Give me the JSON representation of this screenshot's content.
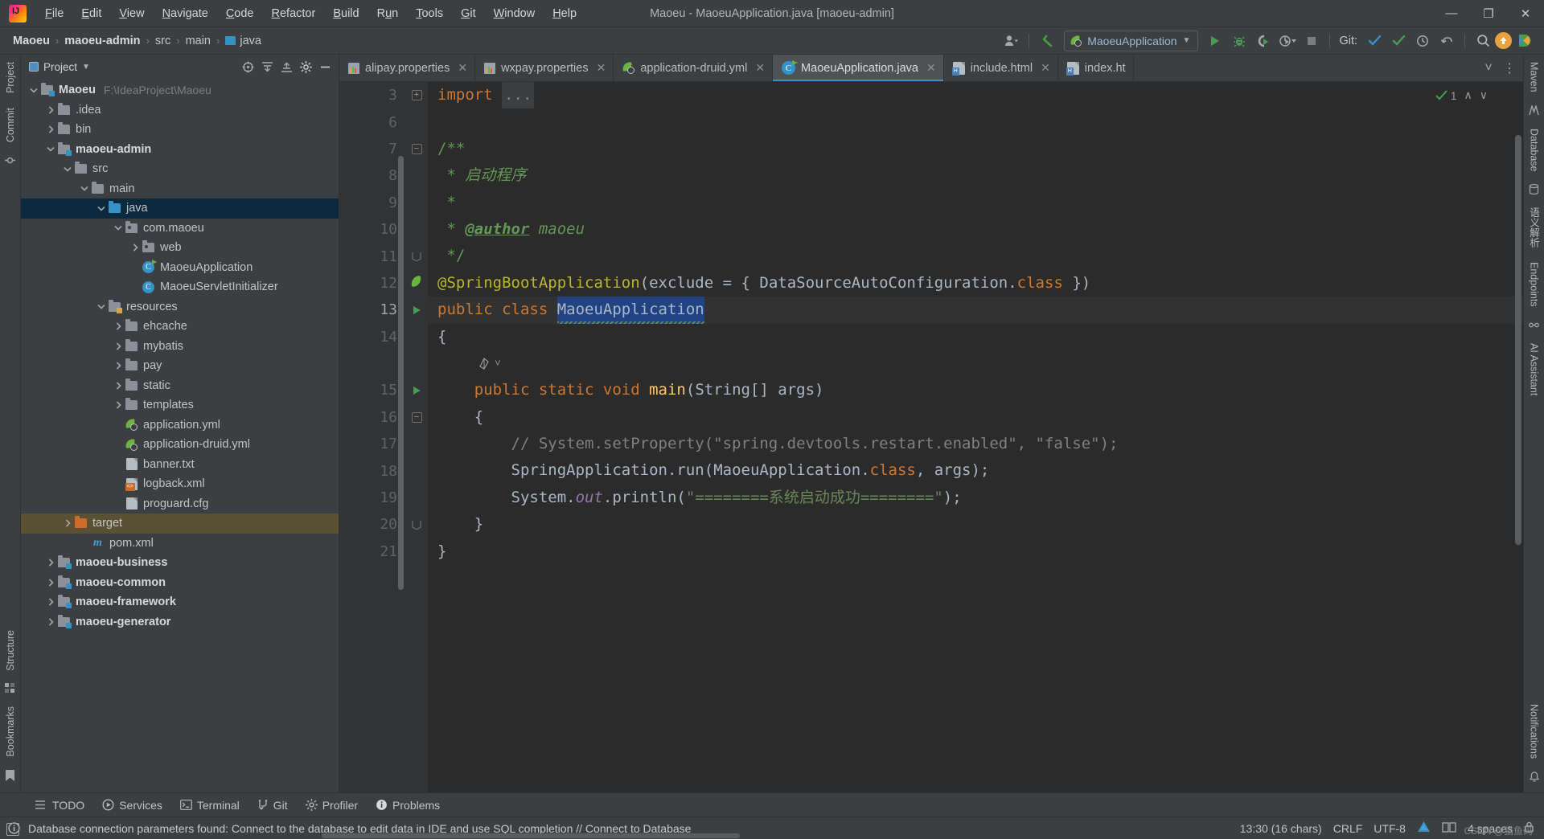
{
  "window": {
    "title": "Maoeu - MaoeuApplication.java [maoeu-admin]",
    "minimize": "—",
    "maximize": "❐",
    "close": "✕"
  },
  "menu": {
    "items": [
      {
        "label": "File"
      },
      {
        "label": "Edit"
      },
      {
        "label": "View"
      },
      {
        "label": "Navigate"
      },
      {
        "label": "Code"
      },
      {
        "label": "Refactor"
      },
      {
        "label": "Build"
      },
      {
        "label": "Run"
      },
      {
        "label": "Tools"
      },
      {
        "label": "Git"
      },
      {
        "label": "Window"
      },
      {
        "label": "Help"
      }
    ]
  },
  "navbar": {
    "breadcrumbs": [
      {
        "label": "Maoeu",
        "bold": true
      },
      {
        "label": "maoeu-admin",
        "bold": true
      },
      {
        "label": "src",
        "bold": false
      },
      {
        "label": "main",
        "bold": false
      },
      {
        "label": "java",
        "bold": false
      }
    ],
    "separator": "›",
    "run_config": "MaoeuApplication",
    "run_config_caret": "▼",
    "git_label": "Git:",
    "icons": {
      "user": "user-icon",
      "back_arrow": "back-arrow-icon",
      "run": "run-icon",
      "debug": "debug-icon",
      "run_coverage": "run-with-coverage-icon",
      "profiler": "profiler-icon",
      "stop": "stop-icon",
      "git_update": "git-update-icon",
      "git_commit": "git-commit-icon",
      "git_history": "git-history-icon",
      "git_rollback": "git-rollback-icon",
      "search": "search-icon",
      "updates": "updates-available-icon",
      "ide_assistant": "ide-assistant-icon"
    }
  },
  "left_strip": {
    "tabs": [
      {
        "label": "Project"
      },
      {
        "label": "Commit"
      },
      {
        "label": "Structure"
      },
      {
        "label": "Bookmarks"
      }
    ]
  },
  "right_strip": {
    "tabs": [
      {
        "label": "Maven"
      },
      {
        "label": "Database"
      },
      {
        "label": "语义解析"
      },
      {
        "label": "Endpoints"
      },
      {
        "label": "AI Assistant"
      },
      {
        "label": "Notifications"
      }
    ]
  },
  "project_panel": {
    "title": "Project",
    "caret": "▼",
    "actions": [
      "locate-icon",
      "expand-all-icon",
      "collapse-all-icon",
      "settings-icon",
      "hide-icon"
    ],
    "tree": [
      {
        "indent": 0,
        "arrow": "down",
        "icon": "module-folder",
        "label": "Maoeu",
        "bold": true,
        "path": "F:\\IdeaProject\\Maoeu"
      },
      {
        "indent": 1,
        "arrow": "right",
        "icon": "folder-grey",
        "label": ".idea",
        "bold": false,
        "path": ""
      },
      {
        "indent": 1,
        "arrow": "right",
        "icon": "folder-grey",
        "label": "bin",
        "bold": false,
        "path": ""
      },
      {
        "indent": 1,
        "arrow": "down",
        "icon": "module-folder",
        "label": "maoeu-admin",
        "bold": true,
        "path": ""
      },
      {
        "indent": 2,
        "arrow": "down",
        "icon": "folder-grey",
        "label": "src",
        "bold": false,
        "path": ""
      },
      {
        "indent": 3,
        "arrow": "down",
        "icon": "folder-grey",
        "label": "main",
        "bold": false,
        "path": ""
      },
      {
        "indent": 4,
        "arrow": "down",
        "icon": "folder-blue",
        "label": "java",
        "bold": false,
        "path": "",
        "selected": true
      },
      {
        "indent": 5,
        "arrow": "down",
        "icon": "package",
        "label": "com.maoeu",
        "bold": false,
        "path": ""
      },
      {
        "indent": 6,
        "arrow": "right",
        "icon": "package",
        "label": "web",
        "bold": false,
        "path": ""
      },
      {
        "indent": 6,
        "arrow": "none",
        "icon": "spring-class",
        "label": "MaoeuApplication",
        "bold": false,
        "path": ""
      },
      {
        "indent": 6,
        "arrow": "none",
        "icon": "java-class",
        "label": "MaoeuServletInitializer",
        "bold": false,
        "path": ""
      },
      {
        "indent": 4,
        "arrow": "down",
        "icon": "resources-folder",
        "label": "resources",
        "bold": false,
        "path": ""
      },
      {
        "indent": 5,
        "arrow": "right",
        "icon": "folder-grey",
        "label": "ehcache",
        "bold": false,
        "path": ""
      },
      {
        "indent": 5,
        "arrow": "right",
        "icon": "folder-grey",
        "label": "mybatis",
        "bold": false,
        "path": ""
      },
      {
        "indent": 5,
        "arrow": "right",
        "icon": "folder-grey",
        "label": "pay",
        "bold": false,
        "path": ""
      },
      {
        "indent": 5,
        "arrow": "right",
        "icon": "folder-grey",
        "label": "static",
        "bold": false,
        "path": ""
      },
      {
        "indent": 5,
        "arrow": "right",
        "icon": "folder-grey",
        "label": "templates",
        "bold": false,
        "path": ""
      },
      {
        "indent": 5,
        "arrow": "none",
        "icon": "spring-yml",
        "label": "application.yml",
        "bold": false,
        "path": ""
      },
      {
        "indent": 5,
        "arrow": "none",
        "icon": "spring-yml",
        "label": "application-druid.yml",
        "bold": false,
        "path": ""
      },
      {
        "indent": 5,
        "arrow": "none",
        "icon": "text-file",
        "label": "banner.txt",
        "bold": false,
        "path": ""
      },
      {
        "indent": 5,
        "arrow": "none",
        "icon": "xml-file",
        "label": "logback.xml",
        "bold": false,
        "path": ""
      },
      {
        "indent": 5,
        "arrow": "none",
        "icon": "cfg-file",
        "label": "proguard.cfg",
        "bold": false,
        "path": ""
      },
      {
        "indent": 2,
        "arrow": "right",
        "icon": "folder-orange",
        "label": "target",
        "bold": false,
        "path": "",
        "target": true
      },
      {
        "indent": 3,
        "arrow": "none",
        "icon": "maven-file",
        "label": "pom.xml",
        "bold": false,
        "path": ""
      },
      {
        "indent": 1,
        "arrow": "right",
        "icon": "module-folder",
        "label": "maoeu-business",
        "bold": true,
        "path": ""
      },
      {
        "indent": 1,
        "arrow": "right",
        "icon": "module-folder",
        "label": "maoeu-common",
        "bold": true,
        "path": ""
      },
      {
        "indent": 1,
        "arrow": "right",
        "icon": "module-folder",
        "label": "maoeu-framework",
        "bold": true,
        "path": ""
      },
      {
        "indent": 1,
        "arrow": "right",
        "icon": "module-folder",
        "label": "maoeu-generator",
        "bold": true,
        "path": ""
      }
    ]
  },
  "editor": {
    "tabs": [
      {
        "label": "alipay.properties",
        "icon": "properties-icon",
        "active": false,
        "close": "✕"
      },
      {
        "label": "wxpay.properties",
        "icon": "properties-icon",
        "active": false,
        "close": "✕"
      },
      {
        "label": "application-druid.yml",
        "icon": "spring-yml-icon",
        "active": false,
        "close": "✕"
      },
      {
        "label": "MaoeuApplication.java",
        "icon": "spring-class-icon",
        "active": true,
        "close": "✕"
      },
      {
        "label": "include.html",
        "icon": "html-icon",
        "active": false,
        "close": "✕"
      },
      {
        "label": "index.ht",
        "icon": "html-icon",
        "active": false,
        "close": ""
      }
    ],
    "tab_overflow": "˅",
    "tab_more": "⋮",
    "inspection_count": "1",
    "inspection_up": "∧",
    "inspection_down": "∨",
    "inlay_hint": "spring-bean-hint",
    "lines": [
      {
        "num": "3",
        "glyph": "fold-plus",
        "segments": [
          {
            "t": "import ",
            "c": "kw"
          },
          {
            "t": "...",
            "c": "fold"
          }
        ]
      },
      {
        "num": "6",
        "glyph": "",
        "segments": []
      },
      {
        "num": "7",
        "glyph": "fold-minus",
        "segments": [
          {
            "t": "/**",
            "c": "doc"
          }
        ]
      },
      {
        "num": "8",
        "glyph": "",
        "segments": [
          {
            "t": " * ",
            "c": "doc"
          },
          {
            "t": "启动程序",
            "c": "docit"
          }
        ]
      },
      {
        "num": "9",
        "glyph": "",
        "segments": [
          {
            "t": " *",
            "c": "doc"
          }
        ]
      },
      {
        "num": "10",
        "glyph": "",
        "segments": [
          {
            "t": " * ",
            "c": "doc"
          },
          {
            "t": "@author",
            "c": "atag"
          },
          {
            "t": " maoeu",
            "c": "docit"
          }
        ]
      },
      {
        "num": "11",
        "glyph": "fold-end",
        "segments": [
          {
            "t": " */",
            "c": "doc"
          }
        ]
      },
      {
        "num": "12",
        "glyph": "spring-bean",
        "segments": [
          {
            "t": "@SpringBootApplication",
            "c": "ann"
          },
          {
            "t": "(exclude = { DataSourceAutoConfiguration.",
            "c": "plain"
          },
          {
            "t": "class",
            "c": "kw"
          },
          {
            "t": " })",
            "c": "plain"
          }
        ]
      },
      {
        "num": "13",
        "glyph": "run",
        "highlight": true,
        "segments": [
          {
            "t": "public class ",
            "c": "kw"
          },
          {
            "t": "MaoeuApplication",
            "c": "selword"
          }
        ]
      },
      {
        "num": "14",
        "glyph": "",
        "segments": [
          {
            "t": "{",
            "c": "plain"
          }
        ]
      },
      {
        "num": "",
        "glyph": "",
        "inlay": true,
        "segments": []
      },
      {
        "num": "15",
        "glyph": "run",
        "segments": [
          {
            "t": "    public static void ",
            "c": "kw"
          },
          {
            "t": "main",
            "c": "mth"
          },
          {
            "t": "(String[] args)",
            "c": "plain"
          }
        ]
      },
      {
        "num": "16",
        "glyph": "fold-minus",
        "segments": [
          {
            "t": "    {",
            "c": "plain"
          }
        ]
      },
      {
        "num": "17",
        "glyph": "",
        "segments": [
          {
            "t": "        // System.setProperty(\"spring.devtools.restart.enabled\", \"false\");",
            "c": "cmt"
          }
        ]
      },
      {
        "num": "18",
        "glyph": "",
        "segments": [
          {
            "t": "        SpringApplication.",
            "c": "plain"
          },
          {
            "t": "run",
            "c": "plain"
          },
          {
            "t": "(MaoeuApplication.",
            "c": "plain"
          },
          {
            "t": "class",
            "c": "kw"
          },
          {
            "t": ", args);",
            "c": "plain"
          }
        ]
      },
      {
        "num": "19",
        "glyph": "",
        "segments": [
          {
            "t": "        System.",
            "c": "plain"
          },
          {
            "t": "out",
            "c": "fldi"
          },
          {
            "t": ".println(",
            "c": "plain"
          },
          {
            "t": "\"========系统启动成功========\"",
            "c": "str"
          },
          {
            "t": ");",
            "c": "plain"
          }
        ]
      },
      {
        "num": "20",
        "glyph": "fold-end",
        "segments": [
          {
            "t": "    }",
            "c": "plain"
          }
        ]
      },
      {
        "num": "21",
        "glyph": "",
        "segments": [
          {
            "t": "}",
            "c": "plain"
          }
        ]
      }
    ]
  },
  "bottom_bar": {
    "items": [
      {
        "label": "TODO",
        "icon": "todo-icon"
      },
      {
        "label": "Services",
        "icon": "services-icon"
      },
      {
        "label": "Terminal",
        "icon": "terminal-icon"
      },
      {
        "label": "Git",
        "icon": "git-icon"
      },
      {
        "label": "Profiler",
        "icon": "profiler-icon"
      },
      {
        "label": "Problems",
        "icon": "problems-icon"
      }
    ]
  },
  "status_bar": {
    "message": "Database connection parameters found: Connect to the database to edit data in IDE and use SQL completion // Connect to Database",
    "caret_position": "13:30 (16 chars)",
    "line_separator": "CRLF",
    "encoding": "UTF-8",
    "indent": "4 spaces",
    "watermark": "CSDN @猫鱼码",
    "icons": [
      "inspection-widget-icon",
      "reader-mode-icon",
      "lock-icon"
    ]
  },
  "colors": {
    "accent_blue": "#4a88c7",
    "selection_blue": "#214283",
    "tree_selection": "#0d293e",
    "target_folder": "#5a5134",
    "editor_bg": "#2b2b2b",
    "panel_bg": "#3c3f41",
    "gutter_bg": "#313335",
    "green_run": "#499c54",
    "spring_green": "#6cb33f",
    "string_green": "#6a8759",
    "keyword_orange": "#cc7832",
    "annotation_yellow": "#bbb529"
  }
}
